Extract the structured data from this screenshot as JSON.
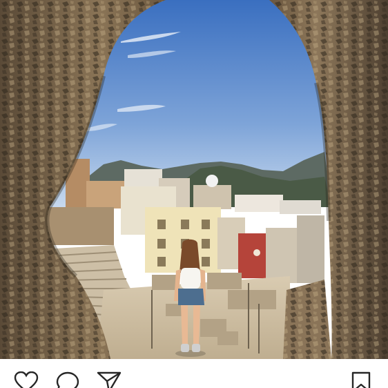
{
  "post": {
    "image_alt": "",
    "actions": {
      "like_icon": "heart-icon",
      "comment_icon": "comment-bubble-icon",
      "share_icon": "paper-plane-icon",
      "save_icon": "bookmark-icon"
    }
  },
  "colors": {
    "icon": "#262626",
    "sky_top": "#3f74c4",
    "sky_bottom": "#b8d0ea",
    "stone_dark": "#3d3428",
    "stone_light": "#a38d6c"
  }
}
